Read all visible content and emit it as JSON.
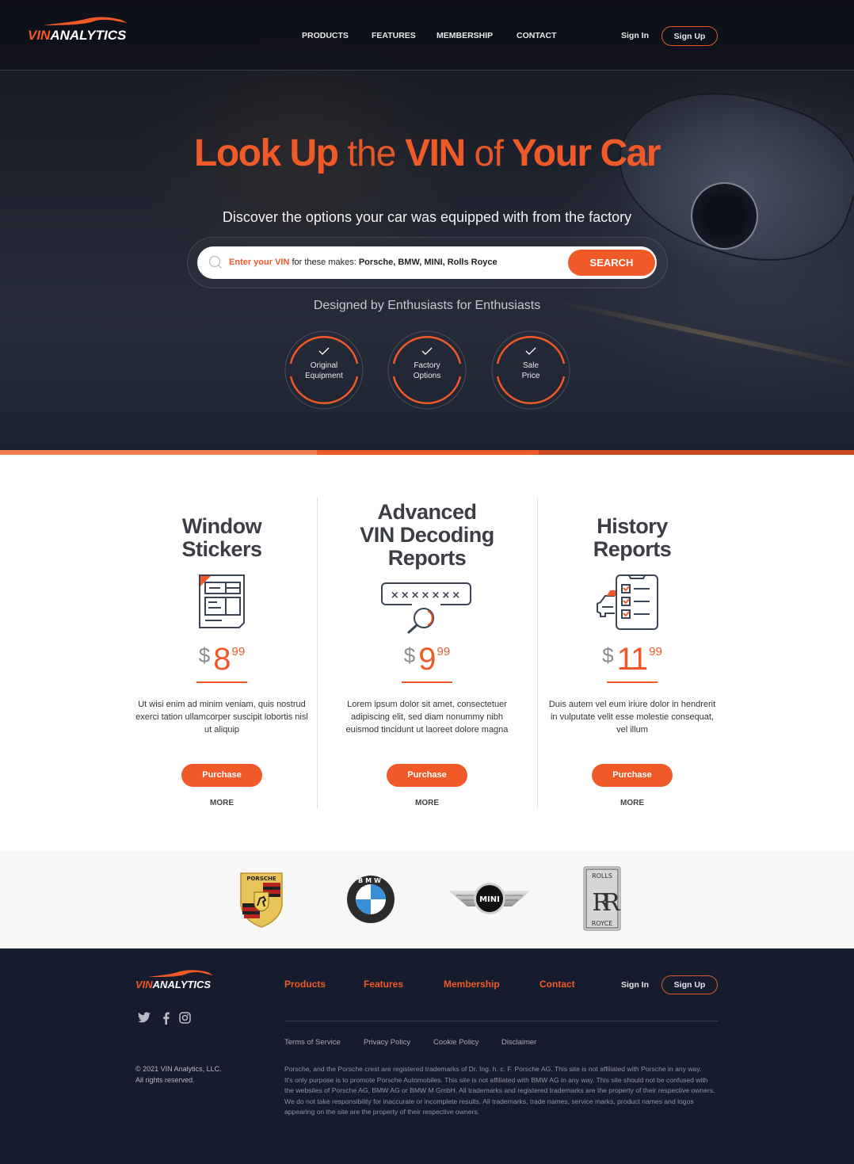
{
  "brand": {
    "vin": "VIN",
    "analytics": "ANALYTICS",
    "accent": "#f05a28",
    "dark_bg": "#161c2d"
  },
  "nav": {
    "links": [
      "PRODUCTS",
      "FEATURES",
      "MEMBERSHIP",
      "CONTACT"
    ],
    "sign_in": "Sign In",
    "sign_up": "Sign Up"
  },
  "hero": {
    "headline": {
      "w1": "Look Up",
      "w2": "the",
      "w3": "VIN",
      "w4": "of",
      "w5": "Your Car"
    },
    "subheadline": "Discover the options your car was equipped with from the factory",
    "search": {
      "placeholder_lead": "Enter your VIN",
      "placeholder_mid": " for these makes: ",
      "placeholder_makes": "Porsche, BMW, MINI, Rolls Royce",
      "button": "SEARCH"
    },
    "tagline": "Designed by Enthusiasts for Enthusiasts",
    "features": [
      {
        "line1": "Original",
        "line2": "Equipment"
      },
      {
        "line1": "Factory",
        "line2": "Options"
      },
      {
        "line1": "Sale",
        "line2": "Price"
      }
    ]
  },
  "products": [
    {
      "title_lines": [
        "Window",
        "Stickers"
      ],
      "currency": "$",
      "price_main": "8",
      "price_cents": "99",
      "description": "Ut wisi enim ad minim veniam, quis nostrud exerci tation ullamcorper suscipit lobortis nisl ut aliquip",
      "button": "Purchase",
      "more": "MORE",
      "icon": "window-sticker-icon"
    },
    {
      "title_lines": [
        "Advanced",
        "VIN Decoding",
        "Reports"
      ],
      "currency": "$",
      "price_main": "9",
      "price_cents": "99",
      "description": "Lorem ipsum dolor sit amet, consectetuer adipiscing elit, sed diam nonummy nibh euismod tincidunt ut laoreet dolore magna",
      "button": "Purchase",
      "more": "MORE",
      "icon": "vin-search-icon",
      "vin_mask": "×××××××"
    },
    {
      "title_lines": [
        "History",
        "Reports"
      ],
      "currency": "$",
      "price_main": "11",
      "price_cents": "99",
      "description": "Duis autem vel eum iriure dolor in hendrerit in vulputate velit esse molestie consequat, vel illum",
      "button": "Purchase",
      "more": "MORE",
      "icon": "history-checklist-icon"
    }
  ],
  "brands": {
    "porsche": "PORSCHE",
    "bmw": "BMW",
    "mini": "MINI",
    "rolls_top": "ROLLS",
    "rolls_mid": "RR",
    "rolls_bottom": "ROYCE"
  },
  "footer": {
    "nav": [
      "Products",
      "Features",
      "Membership",
      "Contact"
    ],
    "sign_in": "Sign In",
    "sign_up": "Sign Up",
    "social": [
      "twitter",
      "facebook",
      "instagram"
    ],
    "links": [
      "Terms of Service",
      "Privacy Policy",
      "Cookie Policy",
      "Disclaimer"
    ],
    "copyright_line1": "© 2021 VIN Analytics, LLC.",
    "copyright_line2": "All rights reserved.",
    "legal": [
      "Porsche, and the Porsche crest are registered trademarks of Dr. Ing. h. c. F. Porsche AG. This site is not affiliated with Porsche in any way.",
      "It's only purpose is to promote Porsche Automobiles. This site is not affiliated with BMW AG in any way. This site should not be confused with",
      "the websites of Porsche AG, BMW AG or BMW M GmbH. All trademarks and registered trademarks are the property of their respective owners.",
      "We do not take responsibility for inaccurate or incomplete results. All trademarks, trade names, service marks, product names and logos",
      "appearing on the site are the property of their respective owners."
    ]
  }
}
